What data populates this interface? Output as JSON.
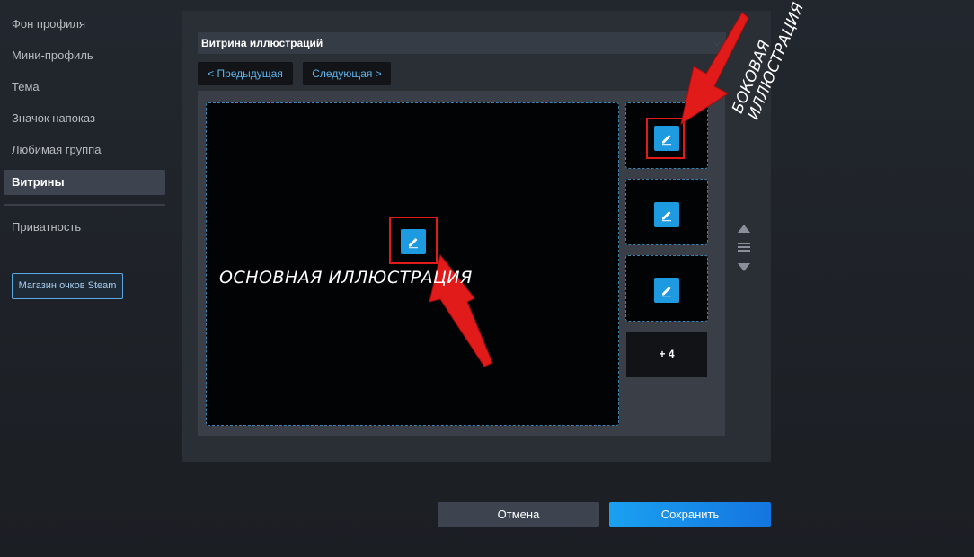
{
  "sidebar": {
    "items": [
      {
        "label": "Фон профиля"
      },
      {
        "label": "Мини-профиль"
      },
      {
        "label": "Тема"
      },
      {
        "label": "Значок напоказ"
      },
      {
        "label": "Любимая группа"
      },
      {
        "label": "Витрины",
        "active": true
      },
      {
        "label": "Приватность"
      }
    ],
    "points_shop_label": "Магазин очков Steam"
  },
  "showcase_select": {
    "value": "Витрина иллюстраций",
    "chevron_icon": "chevron-down-icon"
  },
  "nav": {
    "prev_label": "< Предыдущая",
    "next_label": "Следующая >"
  },
  "slots": {
    "main_edit_icon": "pencil-icon",
    "side_edit_icon": "pencil-icon",
    "more_label": "+ 4"
  },
  "reorder": {
    "up_icon": "arrow-up-icon",
    "handle_icon": "drag-handle-icon",
    "down_icon": "arrow-down-icon"
  },
  "footer": {
    "cancel_label": "Отмена",
    "save_label": "Сохранить"
  },
  "annotations": {
    "main_label": "ОСНОВНАЯ ИЛЛЮСТРАЦИЯ",
    "side_line1": "БОКОВАЯ",
    "side_line2": "ИЛЛЮСТРАЦИЯ",
    "color": "#e11a1a"
  },
  "colors": {
    "accent": "#1e9ae0",
    "sidebar_active_bg": "#3d4450",
    "slot_border": "#3b84ad"
  }
}
